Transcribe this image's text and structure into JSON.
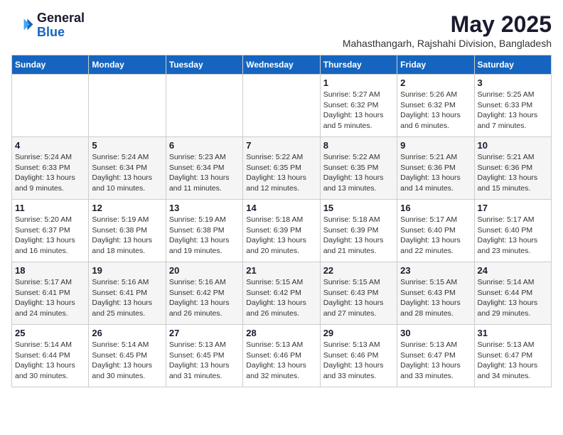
{
  "logo": {
    "general": "General",
    "blue": "Blue"
  },
  "title": {
    "month_year": "May 2025",
    "location": "Mahasthangarh, Rajshahi Division, Bangladesh"
  },
  "days_of_week": [
    "Sunday",
    "Monday",
    "Tuesday",
    "Wednesday",
    "Thursday",
    "Friday",
    "Saturday"
  ],
  "weeks": [
    [
      {
        "day": "",
        "info": ""
      },
      {
        "day": "",
        "info": ""
      },
      {
        "day": "",
        "info": ""
      },
      {
        "day": "",
        "info": ""
      },
      {
        "day": "1",
        "info": "Sunrise: 5:27 AM\nSunset: 6:32 PM\nDaylight: 13 hours\nand 5 minutes."
      },
      {
        "day": "2",
        "info": "Sunrise: 5:26 AM\nSunset: 6:32 PM\nDaylight: 13 hours\nand 6 minutes."
      },
      {
        "day": "3",
        "info": "Sunrise: 5:25 AM\nSunset: 6:33 PM\nDaylight: 13 hours\nand 7 minutes."
      }
    ],
    [
      {
        "day": "4",
        "info": "Sunrise: 5:24 AM\nSunset: 6:33 PM\nDaylight: 13 hours\nand 9 minutes."
      },
      {
        "day": "5",
        "info": "Sunrise: 5:24 AM\nSunset: 6:34 PM\nDaylight: 13 hours\nand 10 minutes."
      },
      {
        "day": "6",
        "info": "Sunrise: 5:23 AM\nSunset: 6:34 PM\nDaylight: 13 hours\nand 11 minutes."
      },
      {
        "day": "7",
        "info": "Sunrise: 5:22 AM\nSunset: 6:35 PM\nDaylight: 13 hours\nand 12 minutes."
      },
      {
        "day": "8",
        "info": "Sunrise: 5:22 AM\nSunset: 6:35 PM\nDaylight: 13 hours\nand 13 minutes."
      },
      {
        "day": "9",
        "info": "Sunrise: 5:21 AM\nSunset: 6:36 PM\nDaylight: 13 hours\nand 14 minutes."
      },
      {
        "day": "10",
        "info": "Sunrise: 5:21 AM\nSunset: 6:36 PM\nDaylight: 13 hours\nand 15 minutes."
      }
    ],
    [
      {
        "day": "11",
        "info": "Sunrise: 5:20 AM\nSunset: 6:37 PM\nDaylight: 13 hours\nand 16 minutes."
      },
      {
        "day": "12",
        "info": "Sunrise: 5:19 AM\nSunset: 6:38 PM\nDaylight: 13 hours\nand 18 minutes."
      },
      {
        "day": "13",
        "info": "Sunrise: 5:19 AM\nSunset: 6:38 PM\nDaylight: 13 hours\nand 19 minutes."
      },
      {
        "day": "14",
        "info": "Sunrise: 5:18 AM\nSunset: 6:39 PM\nDaylight: 13 hours\nand 20 minutes."
      },
      {
        "day": "15",
        "info": "Sunrise: 5:18 AM\nSunset: 6:39 PM\nDaylight: 13 hours\nand 21 minutes."
      },
      {
        "day": "16",
        "info": "Sunrise: 5:17 AM\nSunset: 6:40 PM\nDaylight: 13 hours\nand 22 minutes."
      },
      {
        "day": "17",
        "info": "Sunrise: 5:17 AM\nSunset: 6:40 PM\nDaylight: 13 hours\nand 23 minutes."
      }
    ],
    [
      {
        "day": "18",
        "info": "Sunrise: 5:17 AM\nSunset: 6:41 PM\nDaylight: 13 hours\nand 24 minutes."
      },
      {
        "day": "19",
        "info": "Sunrise: 5:16 AM\nSunset: 6:41 PM\nDaylight: 13 hours\nand 25 minutes."
      },
      {
        "day": "20",
        "info": "Sunrise: 5:16 AM\nSunset: 6:42 PM\nDaylight: 13 hours\nand 26 minutes."
      },
      {
        "day": "21",
        "info": "Sunrise: 5:15 AM\nSunset: 6:42 PM\nDaylight: 13 hours\nand 26 minutes."
      },
      {
        "day": "22",
        "info": "Sunrise: 5:15 AM\nSunset: 6:43 PM\nDaylight: 13 hours\nand 27 minutes."
      },
      {
        "day": "23",
        "info": "Sunrise: 5:15 AM\nSunset: 6:43 PM\nDaylight: 13 hours\nand 28 minutes."
      },
      {
        "day": "24",
        "info": "Sunrise: 5:14 AM\nSunset: 6:44 PM\nDaylight: 13 hours\nand 29 minutes."
      }
    ],
    [
      {
        "day": "25",
        "info": "Sunrise: 5:14 AM\nSunset: 6:44 PM\nDaylight: 13 hours\nand 30 minutes."
      },
      {
        "day": "26",
        "info": "Sunrise: 5:14 AM\nSunset: 6:45 PM\nDaylight: 13 hours\nand 30 minutes."
      },
      {
        "day": "27",
        "info": "Sunrise: 5:13 AM\nSunset: 6:45 PM\nDaylight: 13 hours\nand 31 minutes."
      },
      {
        "day": "28",
        "info": "Sunrise: 5:13 AM\nSunset: 6:46 PM\nDaylight: 13 hours\nand 32 minutes."
      },
      {
        "day": "29",
        "info": "Sunrise: 5:13 AM\nSunset: 6:46 PM\nDaylight: 13 hours\nand 33 minutes."
      },
      {
        "day": "30",
        "info": "Sunrise: 5:13 AM\nSunset: 6:47 PM\nDaylight: 13 hours\nand 33 minutes."
      },
      {
        "day": "31",
        "info": "Sunrise: 5:13 AM\nSunset: 6:47 PM\nDaylight: 13 hours\nand 34 minutes."
      }
    ]
  ]
}
